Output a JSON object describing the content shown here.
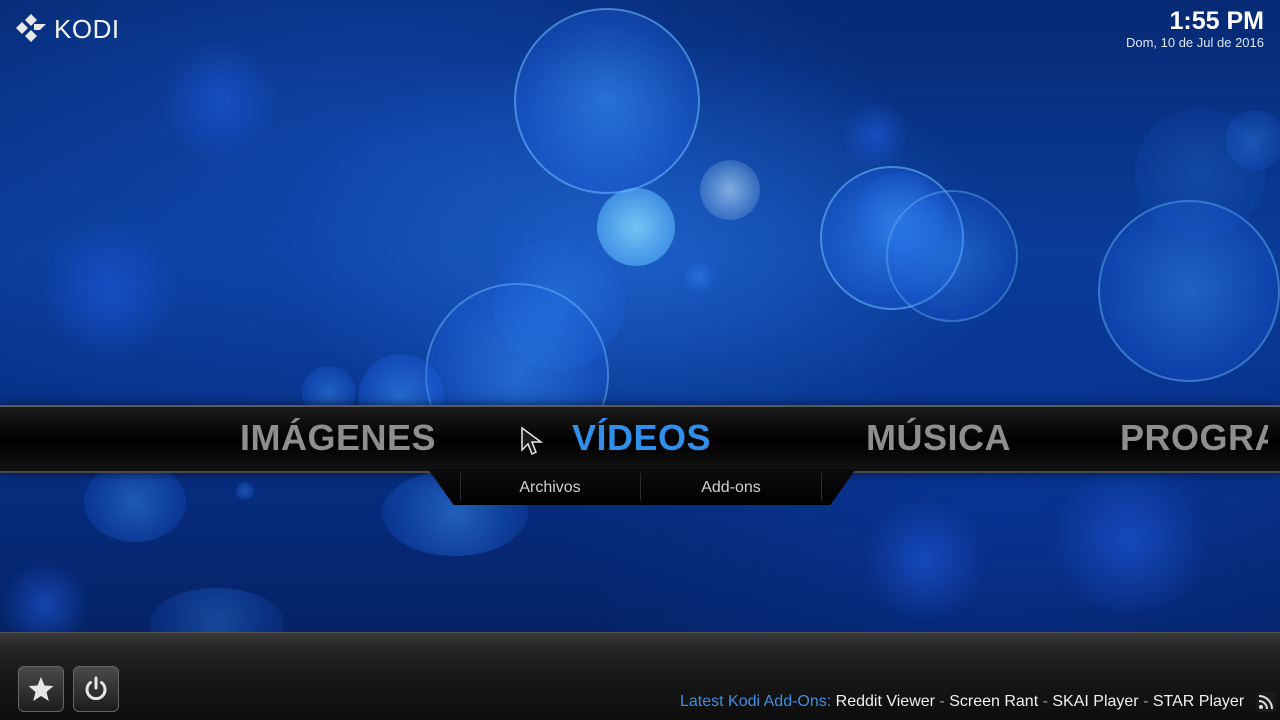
{
  "brand": {
    "logo_text": "KODI"
  },
  "clock": {
    "time": "1:55 PM",
    "date": "Dom, 10 de Jul de 2016"
  },
  "main_menu": {
    "items": [
      {
        "label": "IMÁGENES",
        "active": false
      },
      {
        "label": "VÍDEOS",
        "active": true
      },
      {
        "label": "MÚSICA",
        "active": false
      },
      {
        "label": "PROGRA",
        "active": false
      }
    ]
  },
  "submenu": {
    "items": [
      {
        "label": "Archivos"
      },
      {
        "label": "Add-ons"
      }
    ]
  },
  "bottom": {
    "favourites_icon": "star-icon",
    "power_icon": "power-icon",
    "ticker_heading": "Latest Kodi Add-Ons:",
    "ticker_items": [
      "Reddit Viewer",
      "Screen Rant",
      "SKAI Player",
      "STAR Player"
    ],
    "ticker_separator": "-",
    "rss_icon": "rss-icon"
  },
  "colors": {
    "accent": "#2f8fea",
    "inactive_menu": "#8e8e8e",
    "ticker_heading": "#3d8fe0"
  }
}
